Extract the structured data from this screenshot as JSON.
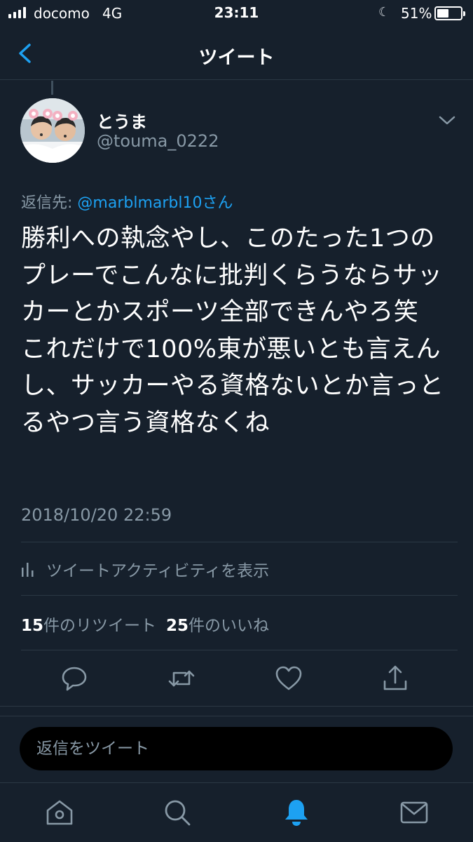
{
  "status_bar": {
    "carrier": "docomo",
    "network": "4G",
    "time": "23:11",
    "battery_percent": "51%",
    "battery_level": 0.51,
    "moon_icon": "moon-icon"
  },
  "nav": {
    "title": "ツイート",
    "back_icon": "chevron-left-icon"
  },
  "tweet": {
    "display_name": "とうま",
    "handle": "@touma_0222",
    "reply_prefix": "返信先: ",
    "reply_mention": "@marblmarbl10さん",
    "text": "勝利への執念やし、このたった1つのプレーでこんなに批判くらうならサッカーとかスポーツ全部できんやろ笑\nこれだけで100%東が悪いとも言えんし、サッカーやる資格ないとか言っとるやつ言う資格なくね",
    "timestamp": "2018/10/20 22:59"
  },
  "activity": {
    "label": "ツイートアクティビティを表示",
    "icon": "bar-chart-icon"
  },
  "stats": {
    "retweets_count": "15",
    "retweets_label": "件のリツイート",
    "likes_count": "25",
    "likes_label": "件のいいね"
  },
  "actions": [
    "reply-icon",
    "retweet-icon",
    "like-icon",
    "share-icon"
  ],
  "reply_input": {
    "placeholder": "返信をツイート"
  },
  "tab_bar": {
    "items": [
      "home-icon",
      "search-icon",
      "notifications-icon",
      "messages-icon"
    ],
    "active": "notifications-icon"
  },
  "colors": {
    "background": "#16202c",
    "accent": "#1da1f2",
    "muted": "#8899a6"
  }
}
